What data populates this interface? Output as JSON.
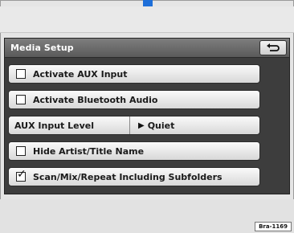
{
  "header": {
    "title": "Media Setup",
    "back_icon": "return-arrow-icon"
  },
  "rows": [
    {
      "label": "Activate AUX Input",
      "checked": false
    },
    {
      "label": "Activate Bluetooth Audio",
      "checked": false
    },
    {
      "label": "AUX Input Level",
      "value": "Quiet"
    },
    {
      "label": "Hide Artist/Title Name",
      "checked": false
    },
    {
      "label": "Scan/Mix/Repeat Including Subfolders",
      "checked": true
    }
  ],
  "figure_ref": "Bra-1169",
  "colors": {
    "accent": "#1e6fd9",
    "panel": "#3d3d3d",
    "header": "#6e6e6e"
  }
}
